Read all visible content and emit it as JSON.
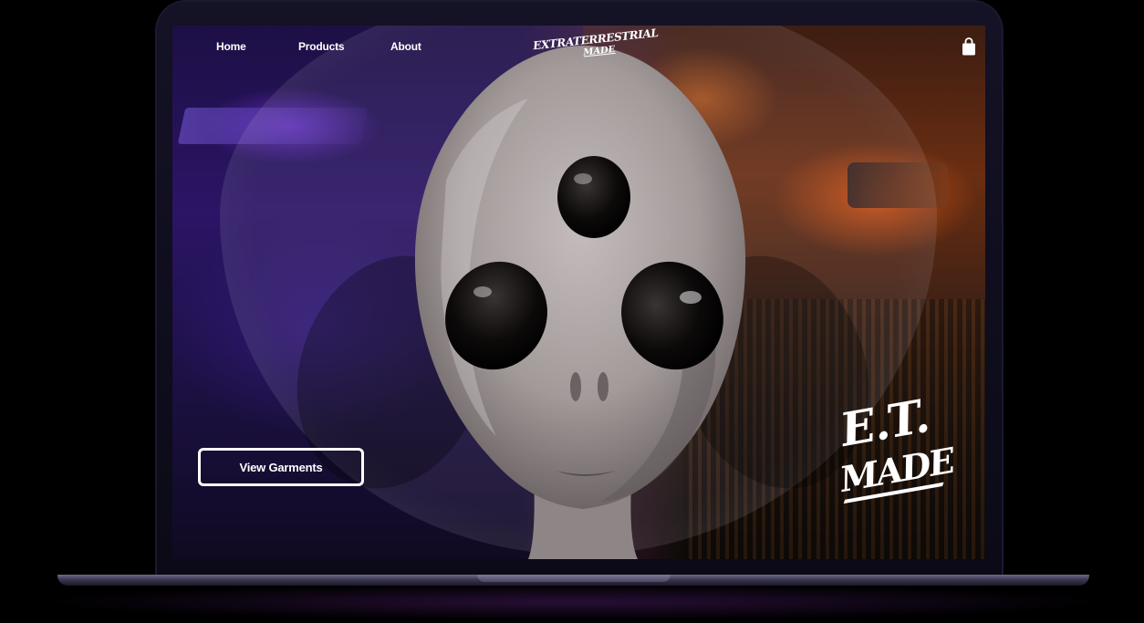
{
  "nav": {
    "home": "Home",
    "products": "Products",
    "about": "About"
  },
  "logo": {
    "line1": "EXTRATERRESTRIAL",
    "line2": "MADE"
  },
  "hero": {
    "cta_label": "View Garments"
  },
  "brand_mark": {
    "line1": "E.T.",
    "line2": "MADE"
  },
  "icons": {
    "cart": "shopping-bag-icon"
  },
  "colors": {
    "nav_text": "#ffffff",
    "left_sky": "#2b1566",
    "right_sky": "#6a2e12",
    "alien_skin": "#a39a9a",
    "eye": "#0c0909"
  }
}
